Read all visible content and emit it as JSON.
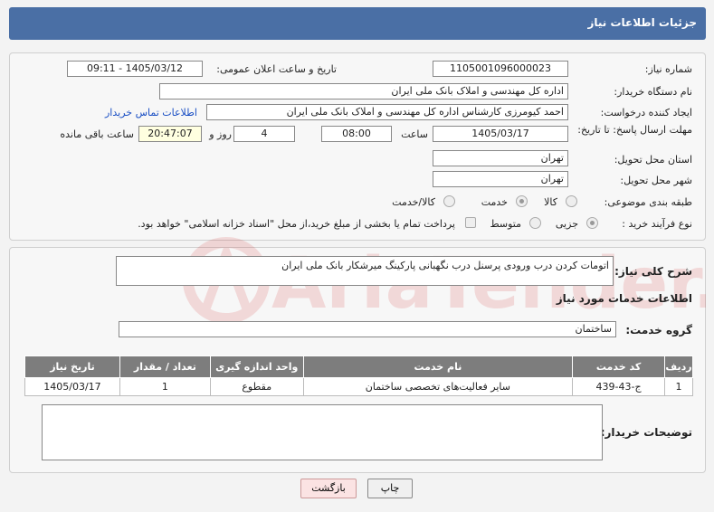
{
  "header": {
    "title": "جزئیات اطلاعات نیاز"
  },
  "form": {
    "need_number": {
      "label": "شماره نیاز:",
      "value": "1105001096000023"
    },
    "announce": {
      "label": "تاریخ و ساعت اعلان عمومی:",
      "value": "1405/03/12 - 09:11"
    },
    "buyer_org": {
      "label": "نام دستگاه خریدار:",
      "value": "اداره کل مهندسی و املاک بانک ملی ایران"
    },
    "requester": {
      "label": "ایجاد کننده درخواست:",
      "value": "احمد کیومرزی کارشناس اداره کل مهندسی و املاک بانک ملی ایران"
    },
    "contact_link": "اطلاعات تماس خریدار",
    "deadline": {
      "label": "مهلت ارسال پاسخ: تا تاریخ:",
      "date": "1405/03/17",
      "time_label": "ساعت",
      "time": "08:00",
      "days": "4",
      "days_label": "روز و",
      "remaining": "20:47:07",
      "remaining_label": "ساعت باقی مانده"
    },
    "province": {
      "label": "استان محل تحویل:",
      "value": "تهران"
    },
    "city": {
      "label": "شهر محل تحویل:",
      "value": "تهران"
    },
    "category": {
      "label": "طبقه بندی موضوعی:",
      "options": [
        "کالا",
        "خدمت",
        "کالا/خدمت"
      ],
      "selected": "خدمت"
    },
    "purchase_type": {
      "label": "نوع فرآیند خرید :",
      "options": [
        "جزیی",
        "متوسط"
      ],
      "selected": "جزیی",
      "payment_note": "پرداخت تمام یا بخشی از مبلغ خرید،از محل \"اسناد خزانه اسلامی\" خواهد بود."
    }
  },
  "description": {
    "label": "شرح کلی نیاز:",
    "value": "اتومات کردن درب ورودی پرسنل درب نگهبانی پارکینگ میرشکار بانک ملی ایران"
  },
  "services": {
    "section_title": "اطلاعات خدمات مورد نیاز",
    "group_label": "گروه خدمت:",
    "group_value": "ساختمان",
    "columns": [
      "ردیف",
      "کد خدمت",
      "نام خدمت",
      "واحد اندازه گیری",
      "تعداد / مقدار",
      "تاریخ نیاز"
    ],
    "rows": [
      [
        "1",
        "ج-43-439",
        "سایر فعالیت‌های تخصصی ساختمان",
        "مقطوع",
        "1",
        "1405/03/17"
      ]
    ]
  },
  "buyer_notes": {
    "label": "توضیحات خریدار:",
    "value": ""
  },
  "buttons": {
    "print": "چاپ",
    "back": "بازگشت"
  },
  "watermark": {
    "text": "AriaTender.net"
  },
  "colors": {
    "header": "#4a6fa5",
    "table_header": "#7d7d7d",
    "link": "#1a4fc4"
  }
}
